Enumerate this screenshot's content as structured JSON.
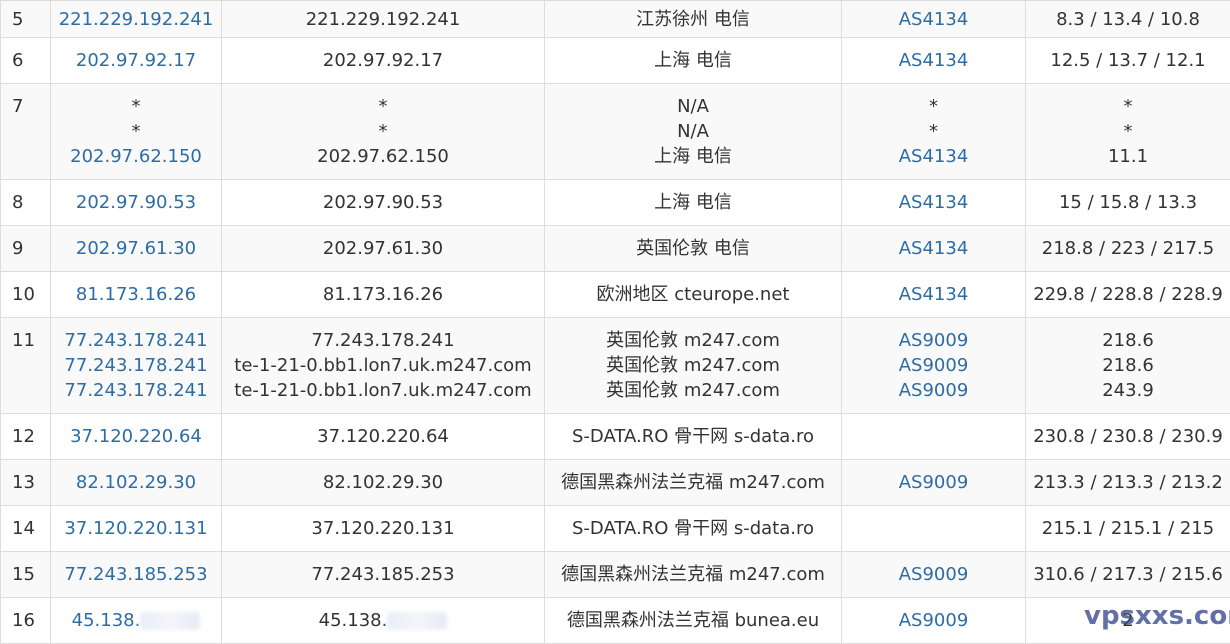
{
  "rows": [
    {
      "hop": "5",
      "ips": [
        "221.229.192.241"
      ],
      "hosts": [
        "221.229.192.241"
      ],
      "locs": [
        "江苏徐州 电信"
      ],
      "asns": [
        "AS4134"
      ],
      "rtts": [
        "8.3 / 13.4 / 10.8"
      ]
    },
    {
      "hop": "6",
      "ips": [
        "202.97.92.17"
      ],
      "hosts": [
        "202.97.92.17"
      ],
      "locs": [
        "上海 电信"
      ],
      "asns": [
        "AS4134"
      ],
      "rtts": [
        "12.5 / 13.7 / 12.1"
      ]
    },
    {
      "hop": "7",
      "ips": [
        "*",
        "*",
        "202.97.62.150"
      ],
      "hosts": [
        "*",
        "*",
        "202.97.62.150"
      ],
      "locs": [
        "N/A",
        "N/A",
        "上海 电信"
      ],
      "asns": [
        "*",
        "*",
        "AS4134"
      ],
      "rtts": [
        "*",
        "*",
        "11.1"
      ]
    },
    {
      "hop": "8",
      "ips": [
        "202.97.90.53"
      ],
      "hosts": [
        "202.97.90.53"
      ],
      "locs": [
        "上海 电信"
      ],
      "asns": [
        "AS4134"
      ],
      "rtts": [
        "15 / 15.8 / 13.3"
      ]
    },
    {
      "hop": "9",
      "ips": [
        "202.97.61.30"
      ],
      "hosts": [
        "202.97.61.30"
      ],
      "locs": [
        "英国伦敦 电信"
      ],
      "asns": [
        "AS4134"
      ],
      "rtts": [
        "218.8 / 223 / 217.5"
      ]
    },
    {
      "hop": "10",
      "ips": [
        "81.173.16.26"
      ],
      "hosts": [
        "81.173.16.26"
      ],
      "locs": [
        "欧洲地区 cteurope.net"
      ],
      "asns": [
        "AS4134"
      ],
      "rtts": [
        "229.8 / 228.8 / 228.9"
      ]
    },
    {
      "hop": "11",
      "ips": [
        "77.243.178.241",
        "77.243.178.241",
        "77.243.178.241"
      ],
      "hosts": [
        "77.243.178.241",
        "te-1-21-0.bb1.lon7.uk.m247.com",
        "te-1-21-0.bb1.lon7.uk.m247.com"
      ],
      "locs": [
        "英国伦敦 m247.com",
        "英国伦敦 m247.com",
        "英国伦敦 m247.com"
      ],
      "asns": [
        "AS9009",
        "AS9009",
        "AS9009"
      ],
      "rtts": [
        "218.6",
        "218.6",
        "243.9"
      ]
    },
    {
      "hop": "12",
      "ips": [
        "37.120.220.64"
      ],
      "hosts": [
        "37.120.220.64"
      ],
      "locs": [
        "S-DATA.RO 骨干网 s-data.ro"
      ],
      "asns": [
        ""
      ],
      "rtts": [
        "230.8 / 230.8 / 230.9"
      ]
    },
    {
      "hop": "13",
      "ips": [
        "82.102.29.30"
      ],
      "hosts": [
        "82.102.29.30"
      ],
      "locs": [
        "德国黑森州法兰克福 m247.com"
      ],
      "asns": [
        "AS9009"
      ],
      "rtts": [
        "213.3 / 213.3 / 213.2"
      ]
    },
    {
      "hop": "14",
      "ips": [
        "37.120.220.131"
      ],
      "hosts": [
        "37.120.220.131"
      ],
      "locs": [
        "S-DATA.RO 骨干网 s-data.ro"
      ],
      "asns": [
        ""
      ],
      "rtts": [
        "215.1 / 215.1 / 215"
      ]
    },
    {
      "hop": "15",
      "ips": [
        "77.243.185.253"
      ],
      "hosts": [
        "77.243.185.253"
      ],
      "locs": [
        "德国黑森州法兰克福 m247.com"
      ],
      "asns": [
        "AS9009"
      ],
      "rtts": [
        "310.6 / 217.3 / 215.6"
      ]
    },
    {
      "hop": "16",
      "ips": [
        "45.138."
      ],
      "hosts": [
        "45.138."
      ],
      "locs": [
        "德国黑森州法兰克福 bunea.eu"
      ],
      "asns": [
        "AS9009"
      ],
      "rtts": [
        "2"
      ],
      "redacted": true
    }
  ],
  "watermark": "vpsxxs.com"
}
